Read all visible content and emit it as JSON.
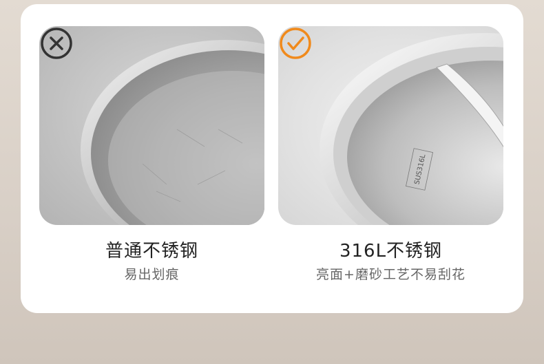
{
  "colors": {
    "accent": "#f08a1c",
    "cross": "#333333",
    "title": "#222222",
    "subtitle": "#666666"
  },
  "left": {
    "icon": "cross-circle-icon",
    "title": "普通不锈钢",
    "subtitle": "易出划痕"
  },
  "right": {
    "icon": "check-circle-icon",
    "title": "316L不锈钢",
    "subtitle": "亮面+磨砂工艺不易刮花",
    "stamp": "SUS316L"
  }
}
